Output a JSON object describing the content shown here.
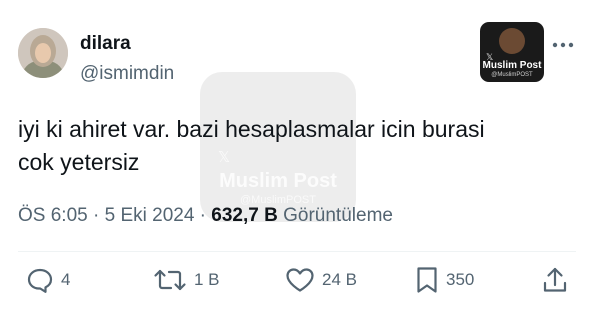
{
  "author": {
    "display_name": "dilara",
    "handle": "@ismimdin"
  },
  "badge": {
    "title": "Muslim Post",
    "subtitle": "@MuslimPOST",
    "x_mark": "𝕏"
  },
  "watermark": {
    "title": "Muslim Post",
    "subtitle": "@MuslimPOST",
    "x_mark": "𝕏"
  },
  "tweet": {
    "text": "iyi ki ahiret var. bazi hesaplasmalar icin burasi\ncok yetersiz"
  },
  "meta": {
    "time": "ÖS 6:05",
    "separator": " · ",
    "date": "5 Eki 2024",
    "views": "632,7 B",
    "views_label": "Görüntüleme"
  },
  "actions": {
    "replies": "4",
    "reposts": "1 B",
    "likes": "24 B",
    "bookmarks": "350"
  },
  "icons": [
    "more-icon",
    "reply-icon",
    "repost-icon",
    "like-icon",
    "bookmark-icon",
    "share-icon"
  ],
  "colors": {
    "text_primary": "#0f1419",
    "text_secondary": "#536471",
    "divider": "#eff3f4"
  }
}
